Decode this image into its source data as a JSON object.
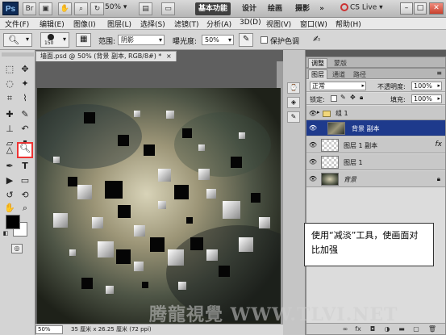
{
  "app": {
    "logo": "Ps",
    "zoom_dropdown": "50%",
    "workspaces": [
      "基本功能",
      "设计",
      "绘画",
      "摄影"
    ],
    "workspace_more": "»",
    "cs_live": "CS Live",
    "window_buttons": [
      "–",
      "□",
      "✕"
    ]
  },
  "menubar": {
    "items": [
      "文件(F)",
      "编辑(E)",
      "图像(I)",
      "图层(L)",
      "选择(S)",
      "滤镜(T)",
      "分析(A)",
      "3D(D)",
      "视图(V)",
      "窗口(W)",
      "帮助(H)"
    ]
  },
  "options": {
    "brush_size": "150",
    "range_label": "范围:",
    "range_value": "阴影",
    "exposure_label": "曝光度:",
    "exposure_value": "50%",
    "protect_tones_label": "保护色调",
    "protect_tones_checked": false
  },
  "document": {
    "tab_title": "墙面.psd @ 50% (背景 副本, RGB/8#) *",
    "tab_close": "×",
    "zoom_field": "50%",
    "status_text": "35 厘米 x 26.25 厘米 (72 ppi)"
  },
  "adjustments_panel": {
    "tabs": [
      "调整",
      "蒙版"
    ]
  },
  "layers_panel": {
    "tabs": [
      "图层",
      "通道",
      "路径"
    ],
    "blend_mode": "正常",
    "opacity_label": "不透明度:",
    "opacity_value": "100%",
    "lock_label": "锁定:",
    "fill_label": "填充:",
    "fill_value": "100%",
    "layers": [
      {
        "name": "组 1",
        "kind": "group"
      },
      {
        "name": "背景 副本",
        "kind": "layer"
      },
      {
        "name": "图层 1 副本",
        "kind": "layer",
        "fx": "fx"
      },
      {
        "name": "图层 1",
        "kind": "layer"
      },
      {
        "name": "背景",
        "kind": "background"
      }
    ]
  },
  "callout": {
    "text": "使用“减淡”工具，使画面对比加强"
  },
  "watermark": "腾龍視覺 WWW.TLVI.NET",
  "colors": {
    "selected_layer": "#1e3a8c",
    "tool_highlight": "#e33333",
    "chrome": "#d6d6d6"
  }
}
